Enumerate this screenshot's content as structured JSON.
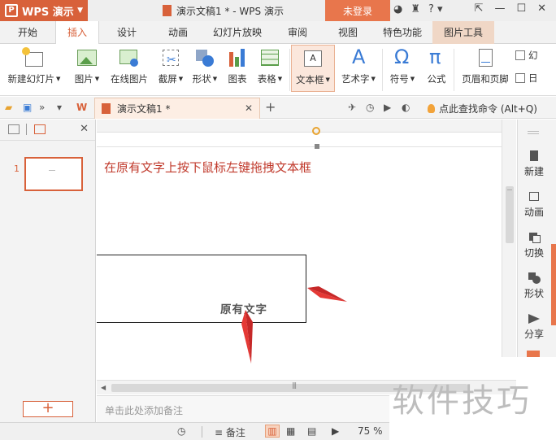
{
  "titlebar": {
    "app_name": "WPS 演示",
    "document_title": "演示文稿1 * - WPS 演示",
    "login_label": "未登录",
    "help_glyph": "?"
  },
  "menu_tabs": [
    "开始",
    "插入",
    "设计",
    "动画",
    "幻灯片放映",
    "审阅",
    "视图",
    "特色功能",
    "图片工具"
  ],
  "active_tab": "插入",
  "ribbon": {
    "new_slide": "新建幻灯片",
    "picture": "图片",
    "online_picture": "在线图片",
    "screenshot": "截屏",
    "shape": "形状",
    "chart": "图表",
    "table": "表格",
    "textbox": "文本框",
    "wordart": "艺术字",
    "symbol": "符号",
    "formula": "公式",
    "header_footer": "页眉和页脚",
    "slide_number_partial": "幻",
    "date_partial": "日"
  },
  "doc_tab": {
    "name": "演示文稿1 *"
  },
  "command_search": "点此查找命令 (Alt+Q)",
  "slides_panel": {
    "slide_number": "1"
  },
  "canvas": {
    "instruction": "在原有文字上按下鼠标左键拖拽文本框",
    "textbox_text": "原有文字"
  },
  "notes_placeholder": "单击此处添加备注",
  "right_sidebar": [
    "新建",
    "动画",
    "切换",
    "形状",
    "分享"
  ],
  "statusbar": {
    "notes_label": "备注",
    "zoom": "75 %"
  },
  "watermark": "软件技巧",
  "colors": {
    "accent": "#d8613a",
    "instruction_red": "#c0392b",
    "arrow_red": "#e53935"
  }
}
